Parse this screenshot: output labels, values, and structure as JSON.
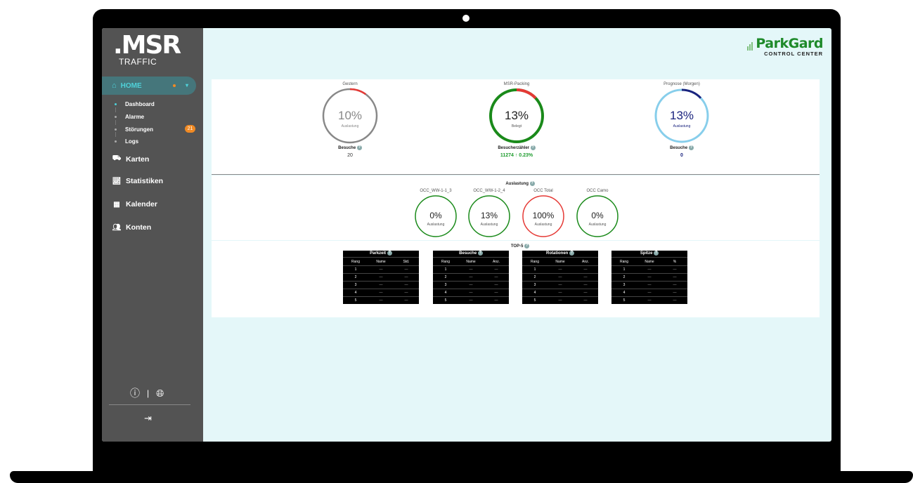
{
  "sidebar": {
    "logo_big": ".MSR",
    "logo_small": "TRAFFIC",
    "home_label": "HOME",
    "sub_items": [
      {
        "label": "Dashboard"
      },
      {
        "label": "Alarme"
      },
      {
        "label": "Störungen"
      },
      {
        "label": "Logs"
      }
    ],
    "stoerungen_badge": "21",
    "nav_items": [
      {
        "label": "Karten",
        "icon": "map-icon"
      },
      {
        "label": "Statistiken",
        "icon": "chart-icon"
      },
      {
        "label": "Kalender",
        "icon": "calendar-icon"
      },
      {
        "label": "Konten",
        "icon": "users-icon"
      }
    ]
  },
  "header": {
    "brand": "ParkGard",
    "subtitle": "CONTROL CENTER"
  },
  "gauges_top": [
    {
      "title": "Gestern",
      "value": "10%",
      "sub": "Auslastung",
      "bottom_label": "Besuche",
      "bottom_value": "20",
      "level": 0.1,
      "color": "#888888",
      "accent": "#e53935"
    },
    {
      "title": "MSR-Packing",
      "value": "13%",
      "sub": "Belegt",
      "bottom_label": "Besucherzähler",
      "bottom_value": "11274 ↑ 0.23%",
      "level": 0.13,
      "color": "#1a8a1a",
      "accent": "#e53935"
    },
    {
      "title": "Prognose (Morgen)",
      "value": "13%",
      "sub": "Auslastung",
      "bottom_label": "Besuche",
      "bottom_value": "0",
      "level": 0.13,
      "color": "#87ceeb",
      "accent": "#1a237e"
    }
  ],
  "auslastung": {
    "title": "Auslastung",
    "gauges": [
      {
        "title": "OCC_WW-1-1_3",
        "value": "0%",
        "sub": "Auslastung",
        "color": "#1a8a1a"
      },
      {
        "title": "OCC_WW-1-2_4",
        "value": "13%",
        "sub": "Auslastung",
        "color": "#1a8a1a"
      },
      {
        "title": "OCC Total",
        "value": "100%",
        "sub": "Auslastung",
        "color": "#e53935"
      },
      {
        "title": "OCC Camo",
        "value": "0%",
        "sub": "Auslastung",
        "color": "#1a8a1a"
      }
    ]
  },
  "top5": {
    "title": "TOP-5",
    "tables": [
      {
        "title": "Parkzeit",
        "cols": [
          "Rang",
          "Name",
          "Std."
        ]
      },
      {
        "title": "Besuche",
        "cols": [
          "Rang",
          "Name",
          "Anz."
        ]
      },
      {
        "title": "Rotationen",
        "cols": [
          "Rang",
          "Name",
          "Anz."
        ]
      },
      {
        "title": "Spitze",
        "cols": [
          "Rang",
          "Name",
          "%"
        ]
      }
    ],
    "rows": [
      [
        "1",
        "—",
        "—"
      ],
      [
        "2",
        "—",
        "—"
      ],
      [
        "3",
        "—",
        "—"
      ],
      [
        "4",
        "—",
        "—"
      ],
      [
        "5",
        "—",
        "—"
      ]
    ]
  },
  "colors": {
    "sidebar_bg": "#535353",
    "accent_teal": "#4fd1d9",
    "badge_orange": "#f08a24",
    "brand_green": "#1e8a2a"
  }
}
